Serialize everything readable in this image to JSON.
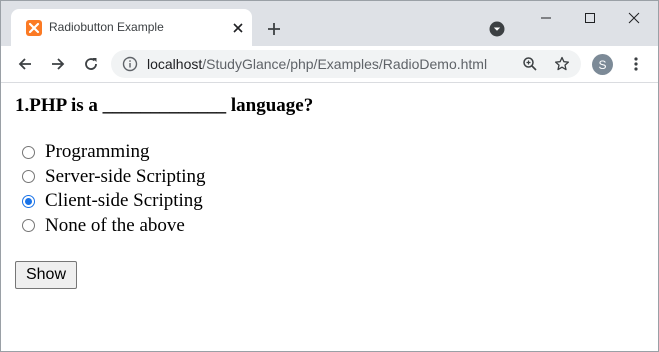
{
  "browser": {
    "tab": {
      "title": "Radiobutton Example",
      "favicon": "xampp-icon"
    },
    "address_bar": {
      "host": "localhost",
      "path": "/StudyGlance/php/Examples/RadioDemo.html"
    },
    "profile_initial": "S"
  },
  "page": {
    "question": "1.PHP is a _____________ language?",
    "options": [
      {
        "label": "Programming",
        "checked": false
      },
      {
        "label": "Server-side Scripting",
        "checked": false
      },
      {
        "label": "Client-side Scripting",
        "checked": true
      },
      {
        "label": "None of the above",
        "checked": false
      }
    ],
    "submit_label": "Show"
  },
  "colors": {
    "accent": "#1a73e8",
    "favicon": "#fb7a24",
    "tabstrip": "#dee1e6"
  }
}
